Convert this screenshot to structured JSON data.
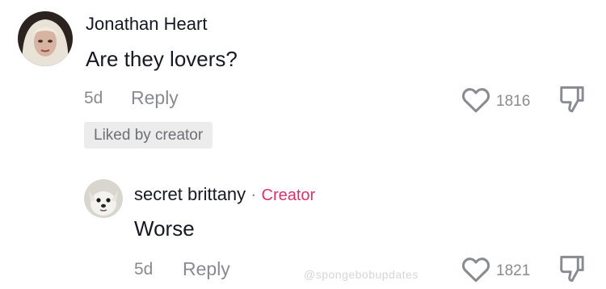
{
  "comment": {
    "username": "Jonathan Heart",
    "text": "Are they lovers?",
    "time": "5d",
    "reply_label": "Reply",
    "likes": "1816",
    "liked_badge": "Liked by creator"
  },
  "reply": {
    "username": "secret brittany",
    "separator": "·",
    "creator_label": "Creator",
    "text": "Worse",
    "time": "5d",
    "reply_label": "Reply",
    "likes": "1821"
  },
  "watermark": "@spongebobupdates",
  "colors": {
    "text": "#161823",
    "muted": "#8a8b91",
    "creator": "#d8336b",
    "badge_bg": "#ececec"
  },
  "icons": {
    "like": "heart-outline-icon",
    "dislike": "thumbs-down-outline-icon"
  }
}
